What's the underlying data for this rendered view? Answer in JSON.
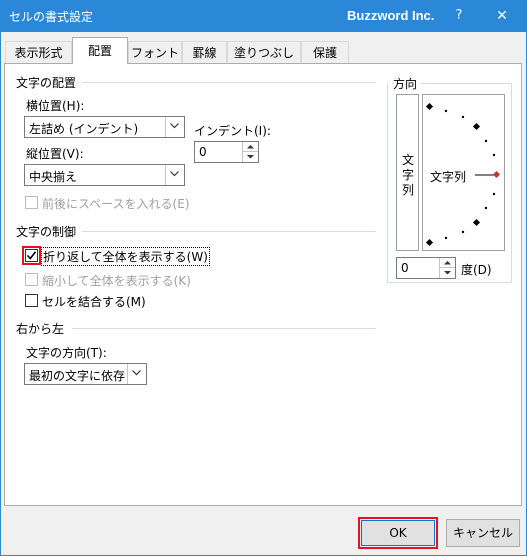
{
  "window": {
    "title": "セルの書式設定",
    "brand": "Buzzword Inc.",
    "help": "?",
    "close": "✕"
  },
  "tabs": [
    {
      "label": "表示形式",
      "active": false
    },
    {
      "label": "配置",
      "active": true
    },
    {
      "label": "フォント",
      "active": false
    },
    {
      "label": "罫線",
      "active": false
    },
    {
      "label": "塗りつぶし",
      "active": false
    },
    {
      "label": "保護",
      "active": false
    }
  ],
  "alignment": {
    "heading": "文字の配置",
    "horizontal_label": "横位置(H):",
    "horizontal_value": "左詰め (インデント)",
    "indent_label": "インデント(I):",
    "indent_value": "0",
    "vertical_label": "縦位置(V):",
    "vertical_value": "中央揃え",
    "justify_distributed_label": "前後にスペースを入れる(E)"
  },
  "text_control": {
    "heading": "文字の制御",
    "wrap_text_label": "折り返して全体を表示する(W)",
    "wrap_text_checked": true,
    "shrink_to_fit_label": "縮小して全体を表示する(K)",
    "shrink_to_fit_checked": false,
    "merge_cells_label": "セルを結合する(M)",
    "merge_cells_checked": false
  },
  "rtl": {
    "heading": "右から左",
    "direction_label": "文字の方向(T):",
    "direction_value": "最初の文字に依存"
  },
  "orientation": {
    "heading": "方向",
    "vertical_text": "文字列",
    "dial_text": "文字列",
    "degrees_value": "0",
    "degrees_label": "度(D)",
    "marker_color": "#c0392b"
  },
  "footer": {
    "ok_label": "OK",
    "cancel_label": "キャンセル"
  },
  "colors": {
    "titlebar": "#2b88d8",
    "highlight": "#e81123",
    "ok_border": "#0078d7"
  }
}
